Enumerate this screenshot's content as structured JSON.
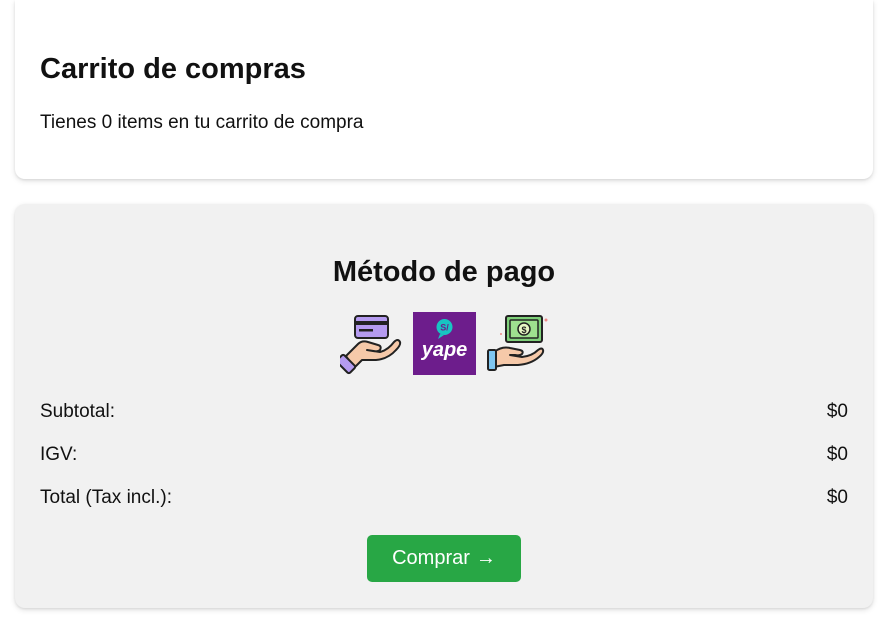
{
  "cart": {
    "title": "Carrito de compras",
    "summary": "Tienes 0 items en tu carrito de compra"
  },
  "payment": {
    "title": "Método de pago",
    "methods": [
      {
        "icon": "card-in-hand-icon"
      },
      {
        "icon": "yape-logo-icon",
        "text": "yape",
        "badge": "S/"
      },
      {
        "icon": "cash-in-hand-icon"
      }
    ],
    "rows": {
      "subtotal_label": "Subtotal:",
      "subtotal_value": "$0",
      "igv_label": "IGV:",
      "igv_value": "$0",
      "total_label": "Total (Tax incl.):",
      "total_value": "$0"
    },
    "buy_label": "Comprar",
    "buy_arrow": "→"
  },
  "colors": {
    "buy_button": "#28a745",
    "payment_bg": "#f1f1f1",
    "yape_purple": "#6d1d8c"
  }
}
